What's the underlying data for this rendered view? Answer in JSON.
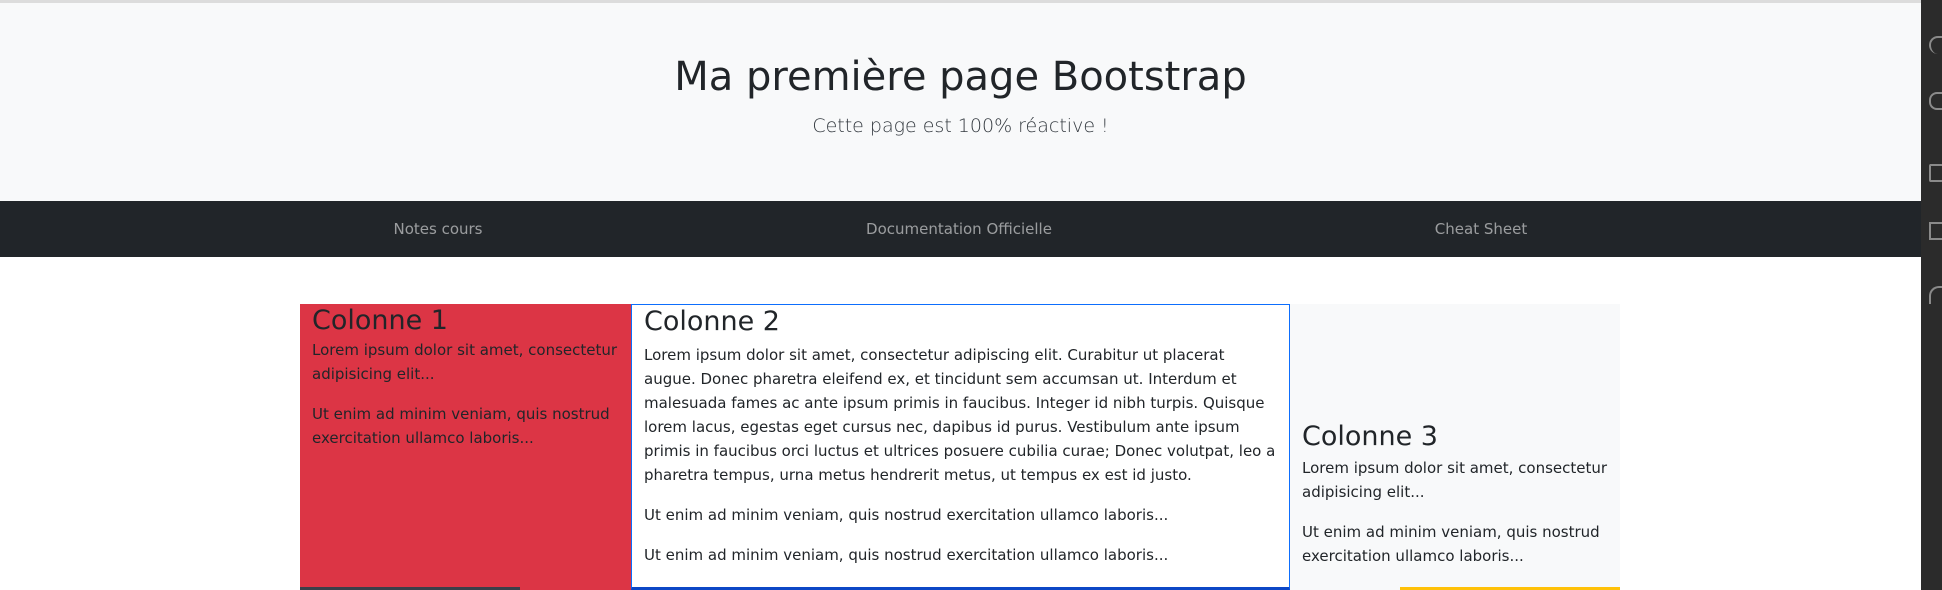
{
  "jumbotron": {
    "title": "Ma première page Bootstrap",
    "lead": "Cette page est 100% réactive !"
  },
  "navbar": {
    "links": [
      {
        "label": "Notes cours"
      },
      {
        "label": "Documentation Officielle"
      },
      {
        "label": "Cheat Sheet"
      }
    ]
  },
  "columns": [
    {
      "heading": "Colonne 1",
      "paragraphs": [
        "Lorem ipsum dolor sit amet, consectetur adipisicing elit...",
        "Ut enim ad minim veniam, quis nostrud exercitation ullamco laboris..."
      ]
    },
    {
      "heading": "Colonne 2",
      "paragraphs": [
        "Lorem ipsum dolor sit amet, consectetur adipiscing elit. Curabitur ut placerat augue. Donec pharetra eleifend ex, et tincidunt sem accumsan ut. Interdum et malesuada fames ac ante ipsum primis in faucibus. Integer id nibh turpis. Quisque lorem lacus, egestas eget cursus nec, dapibus id purus. Vestibulum ante ipsum primis in faucibus orci luctus et ultrices posuere cubilia curae; Donec volutpat, leo a pharetra tempus, urna metus hendrerit metus, ut tempus ex est id justo.",
        "Ut enim ad minim veniam, quis nostrud exercitation ullamco laboris...",
        "Ut enim ad minim veniam, quis nostrud exercitation ullamco laboris..."
      ]
    },
    {
      "heading": "Colonne 3",
      "paragraphs": [
        "Lorem ipsum dolor sit amet, consectetur adipisicing elit...",
        "Ut enim ad minim veniam, quis nostrud exercitation ullamco laboris..."
      ]
    }
  ],
  "colors": {
    "jumbotron_bg": "#f8f9fa",
    "navbar_bg": "#212529",
    "column1_bg": "#dc3545",
    "column2_border": "#0d6efd",
    "column3_bg": "#f8f9fa"
  },
  "side_rail": {
    "icons": [
      "chevron-up-icon",
      "branch-icon",
      "gear-icon",
      "layout-icon",
      "wifi-icon"
    ]
  }
}
